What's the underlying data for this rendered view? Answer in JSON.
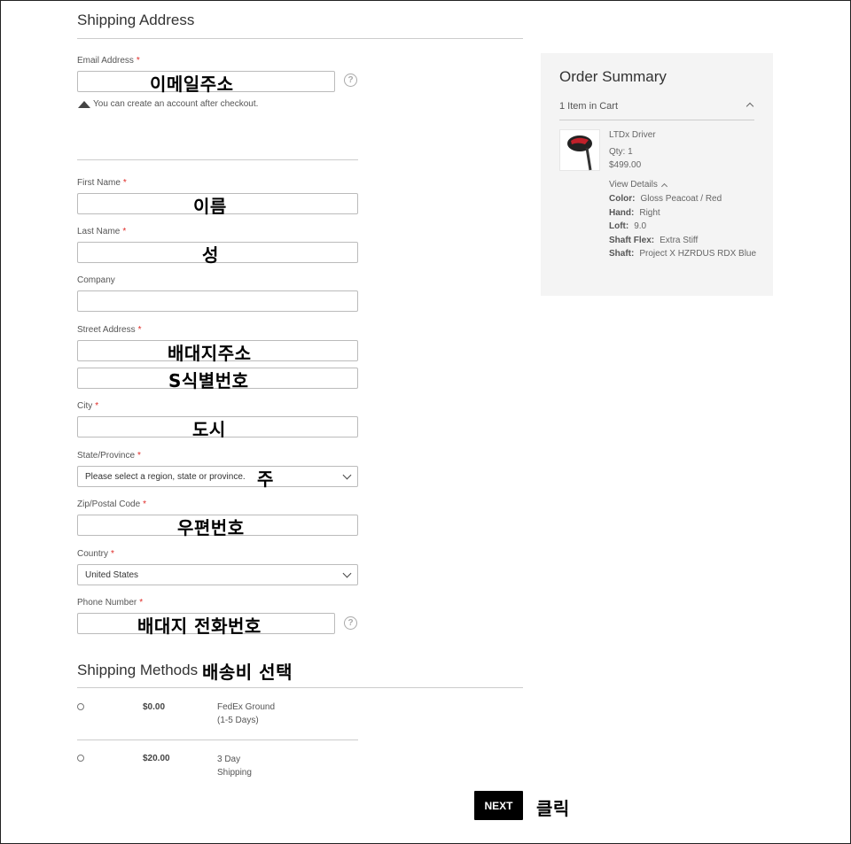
{
  "shipping": {
    "title": "Shipping Address",
    "email_label": "Email Address",
    "email_annotation": "이메일주소",
    "email_note": "You can create an account after checkout.",
    "first_name_label": "First Name",
    "first_name_annotation": "이름",
    "last_name_label": "Last Name",
    "last_name_annotation": "성",
    "company_label": "Company",
    "street_label": "Street Address",
    "street_annotation_1": "배대지주소",
    "street_annotation_2": "S식별번호",
    "city_label": "City",
    "city_annotation": "도시",
    "state_label": "State/Province",
    "state_placeholder": "Please select a region, state or province.",
    "state_annotation": "주",
    "zip_label": "Zip/Postal Code",
    "zip_annotation": "우편번호",
    "country_label": "Country",
    "country_value": "United States",
    "phone_label": "Phone Number",
    "phone_annotation": "배대지 전화번호",
    "required_mark": "*",
    "help_glyph": "?"
  },
  "shipping_methods": {
    "title": "Shipping Methods",
    "annotation": "배송비 선택",
    "options": [
      {
        "price": "$0.00",
        "line1": "FedEx Ground",
        "line2": "(1-5 Days)"
      },
      {
        "price": "$20.00",
        "line1": "3 Day",
        "line2": "Shipping"
      }
    ]
  },
  "next": {
    "label": "NEXT",
    "annotation": "클릭"
  },
  "order_summary": {
    "title": "Order Summary",
    "cart_count": "1 Item in Cart",
    "product_name": "LTDx Driver",
    "qty": "Qty: 1",
    "price": "$499.00",
    "view_details": "View Details",
    "details": [
      {
        "key": "Color:",
        "value": "Gloss Peacoat / Red"
      },
      {
        "key": "Hand:",
        "value": "Right"
      },
      {
        "key": "Loft:",
        "value": "9.0"
      },
      {
        "key": "Shaft Flex:",
        "value": "Extra Stiff"
      },
      {
        "key": "Shaft:",
        "value": "Project X HZRDUS RDX Blue"
      }
    ]
  },
  "icons": {
    "help": "help-circle-icon",
    "select_arrow": "chevron-down-icon",
    "collapse": "chevron-up-icon",
    "note": "triangle-up-icon"
  }
}
